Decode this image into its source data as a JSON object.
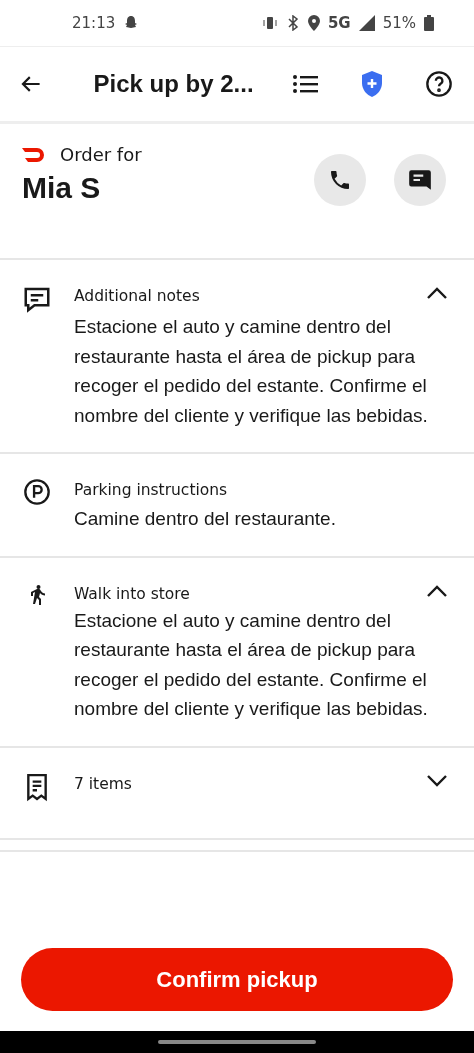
{
  "status_bar": {
    "time": "21:13",
    "network": "5G",
    "battery": "51%"
  },
  "header": {
    "title": "Pick up by 2..."
  },
  "order": {
    "label": "Order for",
    "customer": "Mia S"
  },
  "sections": [
    {
      "kind": "notes",
      "title": "Additional notes",
      "expanded": true,
      "body": "Estacione el auto y camine dentro del restaurante hasta el área de pickup para recoger el pedido del estante. Confirme el nombre del cliente y verifique las bebidas."
    },
    {
      "kind": "parking",
      "title": "Parking instructions",
      "body": "Camine dentro del restaurante."
    },
    {
      "kind": "walk",
      "title": "Walk into store",
      "expanded": true,
      "body": "Estacione el auto y camine dentro del restaurante hasta el área de pickup para recoger el pedido del estante. Confirme el nombre del cliente y verifique las bebidas."
    },
    {
      "kind": "items",
      "title": "7 items",
      "expanded": false
    }
  ],
  "confirm_button": "Confirm pickup"
}
